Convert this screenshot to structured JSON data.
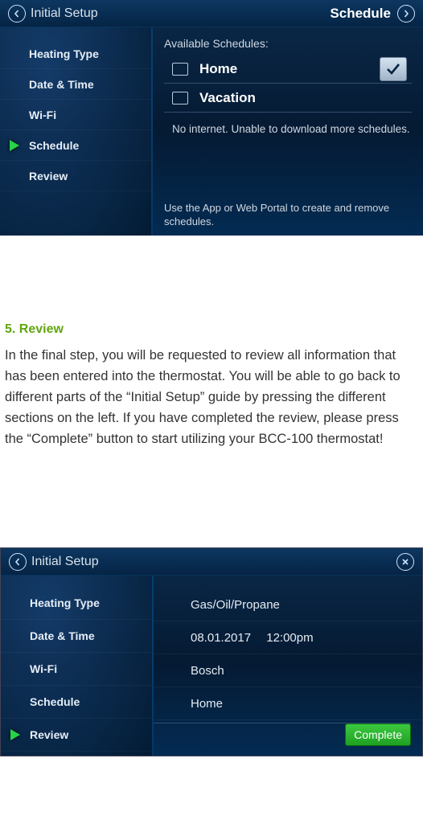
{
  "screen1": {
    "titlebar": {
      "left_label": "Initial Setup",
      "right_label": "Schedule",
      "back_icon": "arrow-left",
      "forward_icon": "arrow-right"
    },
    "nav": [
      {
        "label": "Heating Type",
        "active": false
      },
      {
        "label": "Date & Time",
        "active": false
      },
      {
        "label": "Wi-Fi",
        "active": false
      },
      {
        "label": "Schedule",
        "active": true
      },
      {
        "label": "Review",
        "active": false
      }
    ],
    "available_label": "Available Schedules:",
    "schedules": [
      {
        "name": "Home",
        "selected": true
      },
      {
        "name": "Vacation",
        "selected": false
      }
    ],
    "status_msg": "No internet. Unable to download more schedules.",
    "footnote": "Use the App or Web Portal to create and remove schedules."
  },
  "doc": {
    "heading": "5. Review",
    "body": "In the final step, you will be requested to review all information that has been entered into the thermostat. You will be able to go back to different parts of the “Initial Setup” guide by pressing the different sections on the left. If you have completed the review, please press the “Complete” button to start utilizing your BCC-100 thermostat!"
  },
  "screen2": {
    "titlebar": {
      "left_label": "Initial Setup",
      "back_icon": "arrow-left",
      "close_icon": "close"
    },
    "nav": [
      {
        "label": "Heating Type",
        "active": false
      },
      {
        "label": "Date & Time",
        "active": false
      },
      {
        "label": "Wi-Fi",
        "active": false
      },
      {
        "label": "Schedule",
        "active": false
      },
      {
        "label": "Review",
        "active": true
      }
    ],
    "values": {
      "heating_type": "Gas/Oil/Propane",
      "date_time": "08.01.2017  12:00pm",
      "wifi": "Bosch",
      "schedule": "Home"
    },
    "complete_label": "Complete"
  }
}
